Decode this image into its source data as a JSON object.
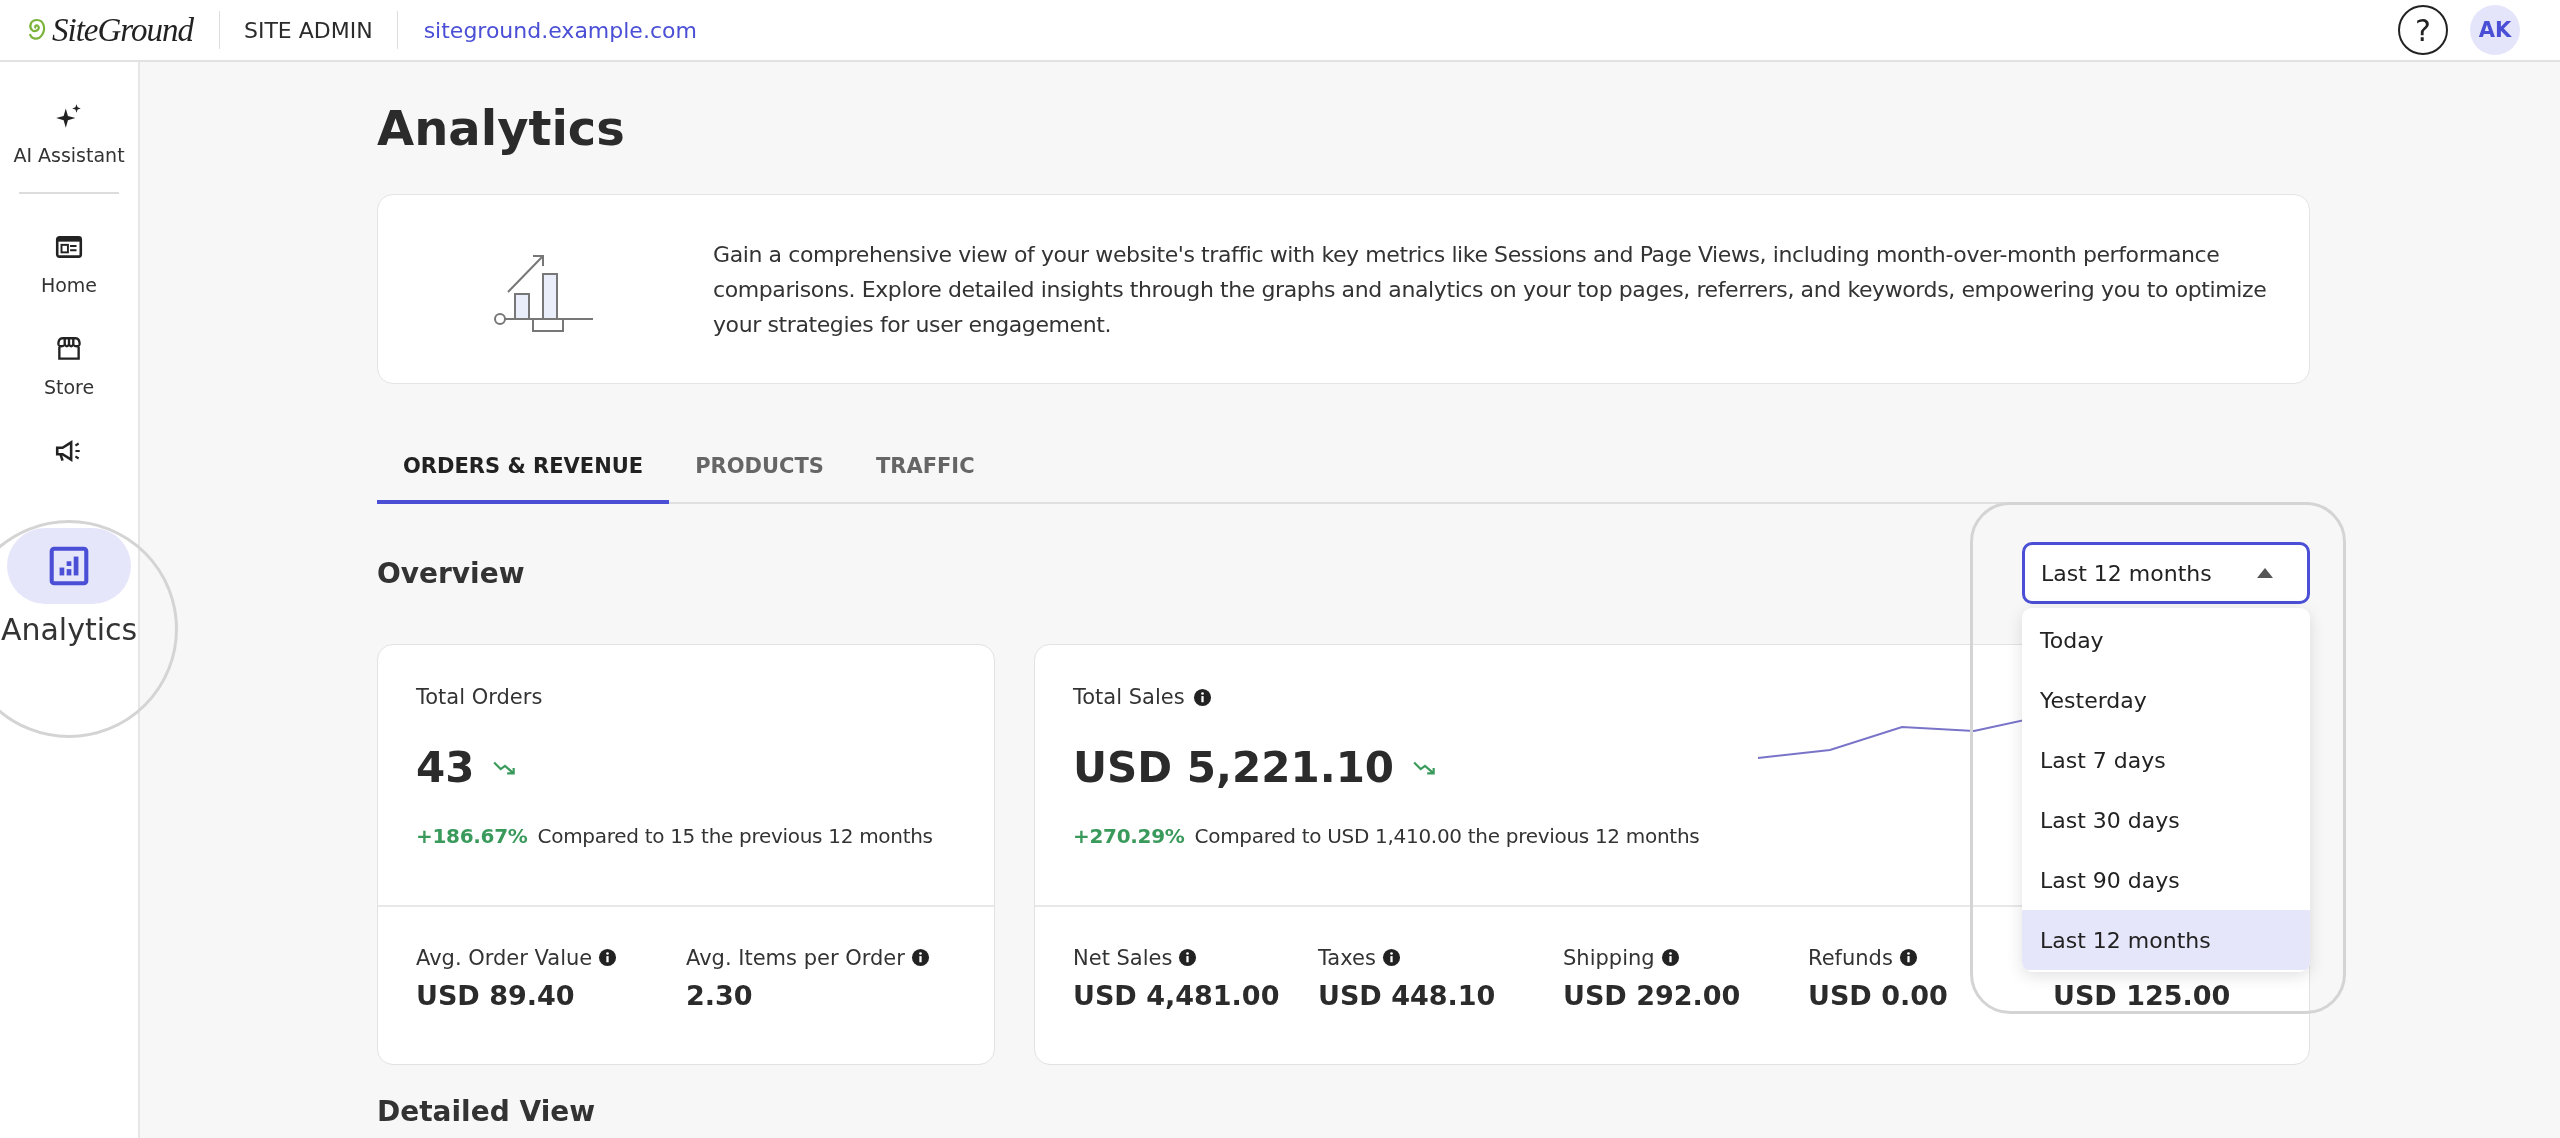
{
  "topbar": {
    "logo": "SiteGround",
    "section": "SITE ADMIN",
    "site": "siteground.example.com",
    "help": "?",
    "avatar": "AK"
  },
  "sidebar": {
    "top": [
      {
        "kind": "sparkle",
        "label": "AI Assistant",
        "selected": false
      }
    ],
    "items": [
      {
        "kind": "home",
        "label": "Home",
        "selected": false
      },
      {
        "kind": "store",
        "label": "Store",
        "selected": false
      },
      {
        "kind": "megaphone",
        "selected": false
      },
      {
        "kind": "analytics",
        "label": "Analytics",
        "selected": true
      }
    ]
  },
  "page": {
    "title": "Analytics",
    "intro": "Gain a comprehensive view of your website's traffic with key metrics like Sessions and Page Views, including month-over-month performance comparisons. Explore detailed insights through the graphs and analytics on your top pages, referrers, and keywords, empowering you to optimize your strategies for user engagement.",
    "tabs": [
      {
        "label": "ORDERS & REVENUE",
        "selected": true
      },
      {
        "label": "PRODUCTS",
        "selected": false
      },
      {
        "label": "TRAFFIC",
        "selected": false
      }
    ],
    "overview": {
      "title": "Overview",
      "period": {
        "value": "Last 12 months",
        "expanded": true,
        "options": [
          {
            "label": "Today",
            "selected": false
          },
          {
            "label": "Yesterday",
            "selected": false
          },
          {
            "label": "Last 7 days",
            "selected": false
          },
          {
            "label": "Last 30 days",
            "selected": false
          },
          {
            "label": "Last 90 days",
            "selected": false
          },
          {
            "label": "Last 12 months",
            "selected": true
          }
        ]
      },
      "cards": [
        {
          "title": "Total Orders",
          "info": false,
          "value": "43",
          "change": "+186.67%",
          "comparison": "Compared to 15 the previous 12 months",
          "sparkline": false,
          "metrics": [
            {
              "label": "Avg. Order Value",
              "value": "USD 89.40"
            },
            {
              "label": "Avg. Items per Order",
              "value": "2.30"
            }
          ]
        },
        {
          "title": "Total Sales",
          "info": true,
          "value": "USD 5,221.10",
          "change": "+270.29%",
          "comparison": "Compared to USD 1,410.00 the previous 12 months",
          "sparkline": true,
          "metrics": [
            {
              "label": "Net Sales",
              "value": "USD 4,481.00"
            },
            {
              "label": "Taxes",
              "value": "USD 448.10"
            },
            {
              "label": "Shipping",
              "value": "USD 292.00"
            },
            {
              "label": "Refunds",
              "value": "USD 0.00"
            },
            {
              "value": "USD 125.00"
            }
          ]
        }
      ]
    },
    "detailed_title": "Detailed View"
  }
}
